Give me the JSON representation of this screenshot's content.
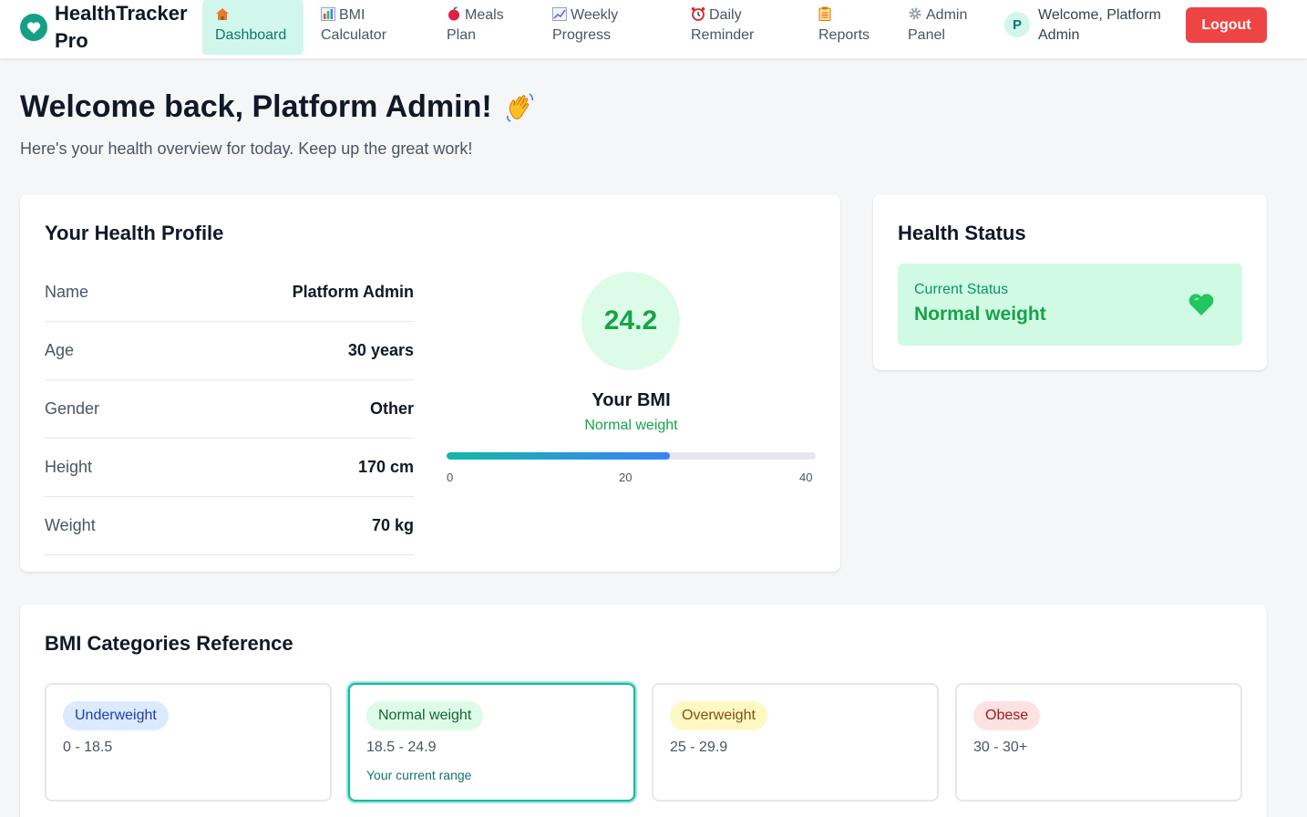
{
  "header": {
    "brand": "HealthTracker Pro",
    "nav": [
      {
        "icon": "house-icon",
        "label": "Dashboard"
      },
      {
        "icon": "bar-chart-icon",
        "label": "BMI Calculator"
      },
      {
        "icon": "apple-icon",
        "label": "Meals Plan"
      },
      {
        "icon": "line-chart-icon",
        "label": "Weekly Progress"
      },
      {
        "icon": "alarm-clock-icon",
        "label": "Daily Reminder"
      },
      {
        "icon": "clipboard-icon",
        "label": "Reports"
      },
      {
        "icon": "gear-icon",
        "label": "Admin Panel"
      }
    ],
    "active_nav": "Dashboard",
    "user_initial": "P",
    "user_greeting": "Welcome, Platform Admin",
    "logout_label": "Logout"
  },
  "welcome": {
    "title": "Welcome back, Platform Admin!",
    "subtitle": "Here's your health overview for today. Keep up the great work!"
  },
  "profile": {
    "title": "Your Health Profile",
    "rows": [
      {
        "label": "Name",
        "value": "Platform Admin"
      },
      {
        "label": "Age",
        "value": "30 years"
      },
      {
        "label": "Gender",
        "value": "Other"
      },
      {
        "label": "Height",
        "value": "170 cm"
      },
      {
        "label": "Weight",
        "value": "70 kg"
      }
    ],
    "bmi_value": "24.2",
    "bmi_label": "Your BMI",
    "bmi_status": "Normal weight",
    "bmi_scale": {
      "min": "0",
      "mid": "20",
      "max": "40"
    },
    "bmi_progress_fraction": 0.605
  },
  "health_status": {
    "title": "Health Status",
    "caption": "Current Status",
    "value": "Normal weight"
  },
  "categories": {
    "title": "BMI Categories Reference",
    "items": [
      {
        "name": "Underweight",
        "range": "0 - 18.5",
        "badge_bg": "#dbeafe",
        "badge_fg": "#1e40af",
        "current": false,
        "note": ""
      },
      {
        "name": "Normal weight",
        "range": "18.5 - 24.9",
        "badge_bg": "#dcfce7",
        "badge_fg": "#166534",
        "current": true,
        "note": "Your current range"
      },
      {
        "name": "Overweight",
        "range": "25 - 29.9",
        "badge_bg": "#fef9c3",
        "badge_fg": "#854d0e",
        "current": false,
        "note": ""
      },
      {
        "name": "Obese",
        "range": "30 - 30+",
        "badge_bg": "#fee2e2",
        "badge_fg": "#991b1b",
        "current": false,
        "note": ""
      }
    ]
  },
  "colors": {
    "accent": "#14a085",
    "logout": "#ef4444",
    "normal_green": "#16a34a"
  }
}
